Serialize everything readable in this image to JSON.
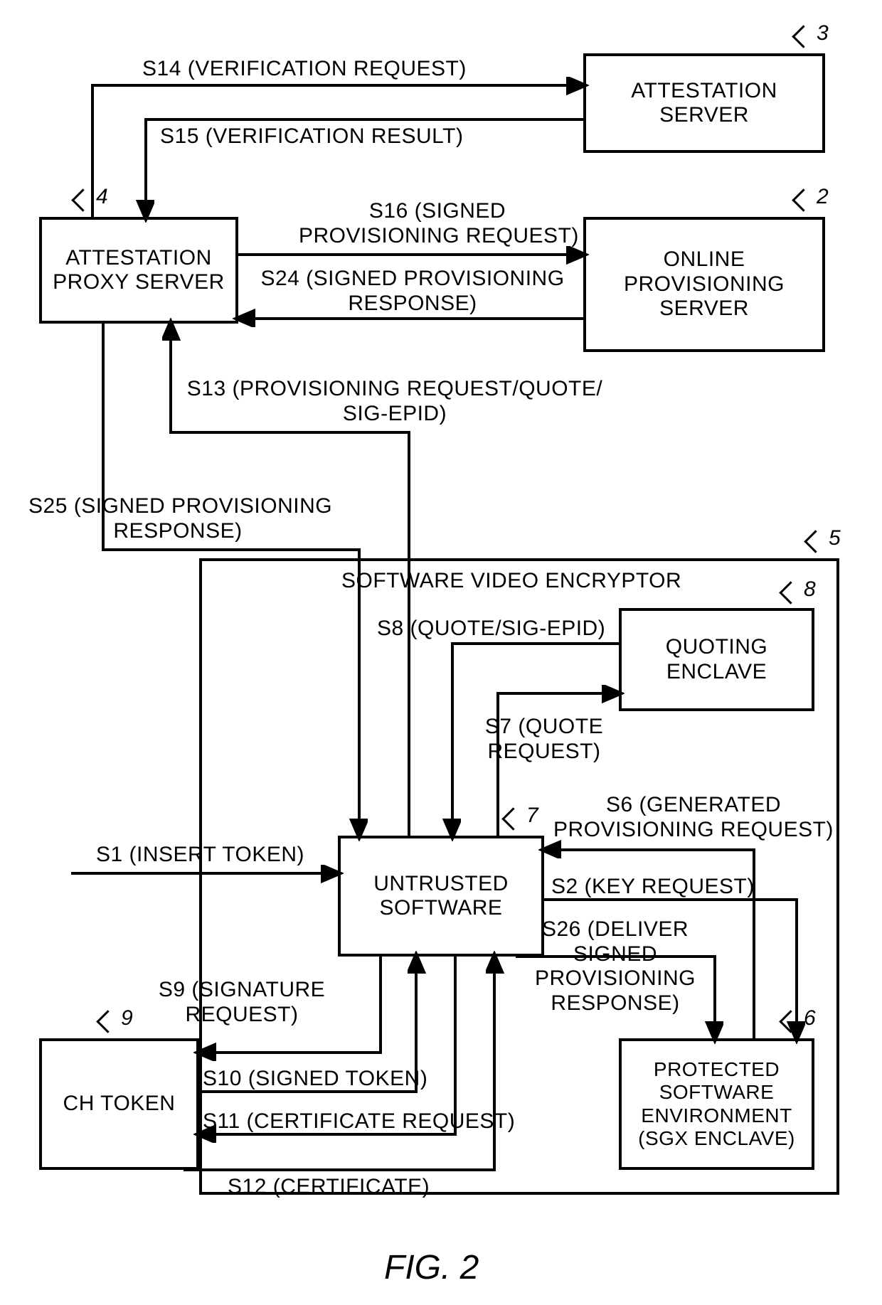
{
  "figure_caption": "FIG. 2",
  "nodes": {
    "attestation_server": {
      "label": "ATTESTATION\nSERVER",
      "ref": "3"
    },
    "online_provisioning_server": {
      "label": "ONLINE\nPROVISIONING\nSERVER",
      "ref": "2"
    },
    "attestation_proxy_server": {
      "label": "ATTESTATION\nPROXY SERVER",
      "ref": "4"
    },
    "software_video_encryptor": {
      "label": "SOFTWARE VIDEO ENCRYPTOR",
      "ref": "5"
    },
    "quoting_enclave": {
      "label": "QUOTING\nENCLAVE",
      "ref": "8"
    },
    "untrusted_software": {
      "label": "UNTRUSTED\nSOFTWARE",
      "ref": "7"
    },
    "protected_software_environment": {
      "label": "PROTECTED\nSOFTWARE\nENVIRONMENT\n(SGX ENCLAVE)",
      "ref": "6"
    },
    "ch_token": {
      "label": "CH TOKEN",
      "ref": "9"
    }
  },
  "edges": {
    "s1": "S1 (INSERT TOKEN)",
    "s2": "S2 (KEY REQUEST)",
    "s6": "S6 (GENERATED\nPROVISIONING REQUEST)",
    "s7": "S7 (QUOTE\nREQUEST)",
    "s8": "S8 (QUOTE/SIG-EPID)",
    "s9": "S9 (SIGNATURE\nREQUEST)",
    "s10": "S10 (SIGNED TOKEN)",
    "s11": "S11 (CERTIFICATE REQUEST)",
    "s12": "S12 (CERTIFICATE)",
    "s13": "S13 (PROVISIONING REQUEST/QUOTE/\nSIG-EPID)",
    "s14": "S14 (VERIFICATION REQUEST)",
    "s15": "S15 (VERIFICATION RESULT)",
    "s16": "S16 (SIGNED\nPROVISIONING REQUEST)",
    "s24": "S24 (SIGNED PROVISIONING\nRESPONSE)",
    "s25": "S25 (SIGNED PROVISIONING\nRESPONSE)",
    "s26": "S26 (DELIVER\nSIGNED\nPROVISIONING\nRESPONSE)"
  }
}
